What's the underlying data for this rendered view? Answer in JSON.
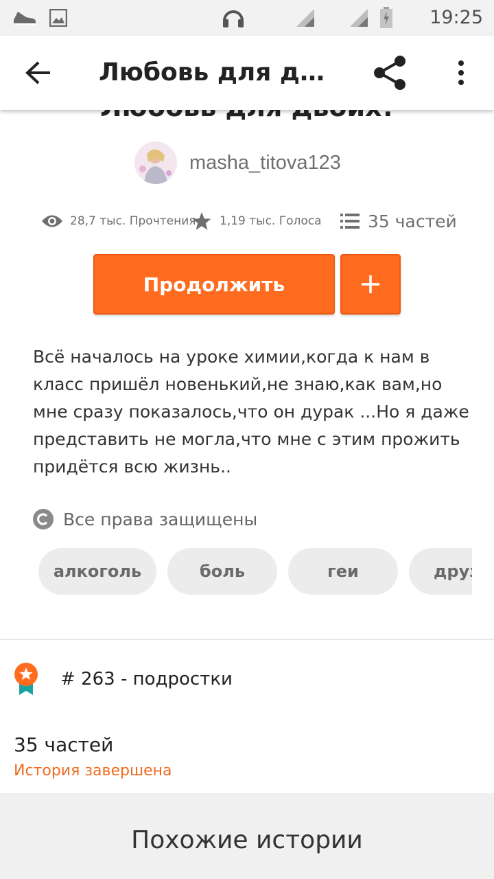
{
  "status_bar": {
    "time": "19:25",
    "icons": [
      "sneaker-icon",
      "image-icon",
      "headset-icon",
      "signal-icon",
      "signal-icon",
      "battery-icon"
    ]
  },
  "app_bar": {
    "title": "Любовь для дво…",
    "back_icon": "arrow-left-icon",
    "share_icon": "share-icon",
    "menu_icon": "more-vertical-icon"
  },
  "story": {
    "title": "Любовь для двоих!",
    "author": "masha_titova123",
    "reads": "28,7 тыс. Прочтения",
    "votes": "1,19 тыс. Голоса",
    "parts": "35 частей",
    "continue_label": "Продолжить",
    "add_label": "+",
    "description": "Всё началось на уроке химии,когда к нам в класс пришёл новенький,не знаю,как вам,но мне сразу показалось,что он дурак ...Но я даже представить не могла,что мне с этим  прожить придётся всю жизнь..",
    "copyright": "Все права защищены",
    "tags": [
      "алкоголь",
      "боль",
      "геи",
      "друзья"
    ]
  },
  "ranking": {
    "text": "# 263 - подростки",
    "icon": "ranking-medal-icon"
  },
  "summary": {
    "parts": "35 частей",
    "status": "История завершена"
  },
  "similar": {
    "title": "Похожие истории"
  },
  "colors": {
    "accent": "#ff6c1f",
    "status_text": "#f06a1e",
    "medal_ribbon": "#1aa3a3"
  }
}
